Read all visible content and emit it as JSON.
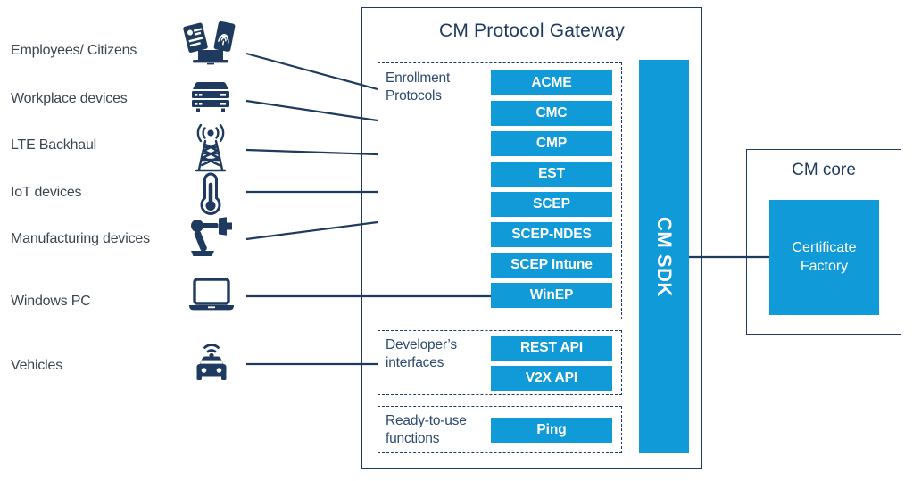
{
  "diagram": {
    "colors": {
      "accent_blue": "#119ad8",
      "dark_navy": "#1e3a5f",
      "label_gray": "#3c4650",
      "background": "#ffffff"
    }
  },
  "devices": [
    {
      "label": "Employees/ Citizens",
      "icon": "devices-mobile-laptop-fingerprint-icon"
    },
    {
      "label": "Workplace devices",
      "icon": "server-rack-icon"
    },
    {
      "label": "LTE Backhaul",
      "icon": "cell-tower-icon"
    },
    {
      "label": "IoT devices",
      "icon": "thermometer-sensor-icon"
    },
    {
      "label": "Manufacturing devices",
      "icon": "robot-arm-icon"
    },
    {
      "label": "Windows PC",
      "icon": "laptop-icon"
    },
    {
      "label": "Vehicles",
      "icon": "connected-car-icon"
    }
  ],
  "gateway": {
    "title": "CM Protocol Gateway",
    "sdk_label": "CM SDK",
    "sections": [
      {
        "name": "enrollment-protocols",
        "label_line1": "Enrollment",
        "label_line2": "Protocols",
        "chips": [
          "ACME",
          "CMC",
          "CMP",
          "EST",
          "SCEP",
          "SCEP-NDES",
          "SCEP Intune",
          "WinEP"
        ]
      },
      {
        "name": "developers-interfaces",
        "label_line1": "Developer’s",
        "label_line2": "interfaces",
        "chips": [
          "REST API",
          "V2X API"
        ]
      },
      {
        "name": "ready-to-use-functions",
        "label_line1": "Ready-to-use",
        "label_line2": "functions",
        "chips": [
          "Ping"
        ]
      }
    ]
  },
  "cm_core": {
    "title": "CM core",
    "component_line1": "Certificate",
    "component_line2": "Factory"
  }
}
